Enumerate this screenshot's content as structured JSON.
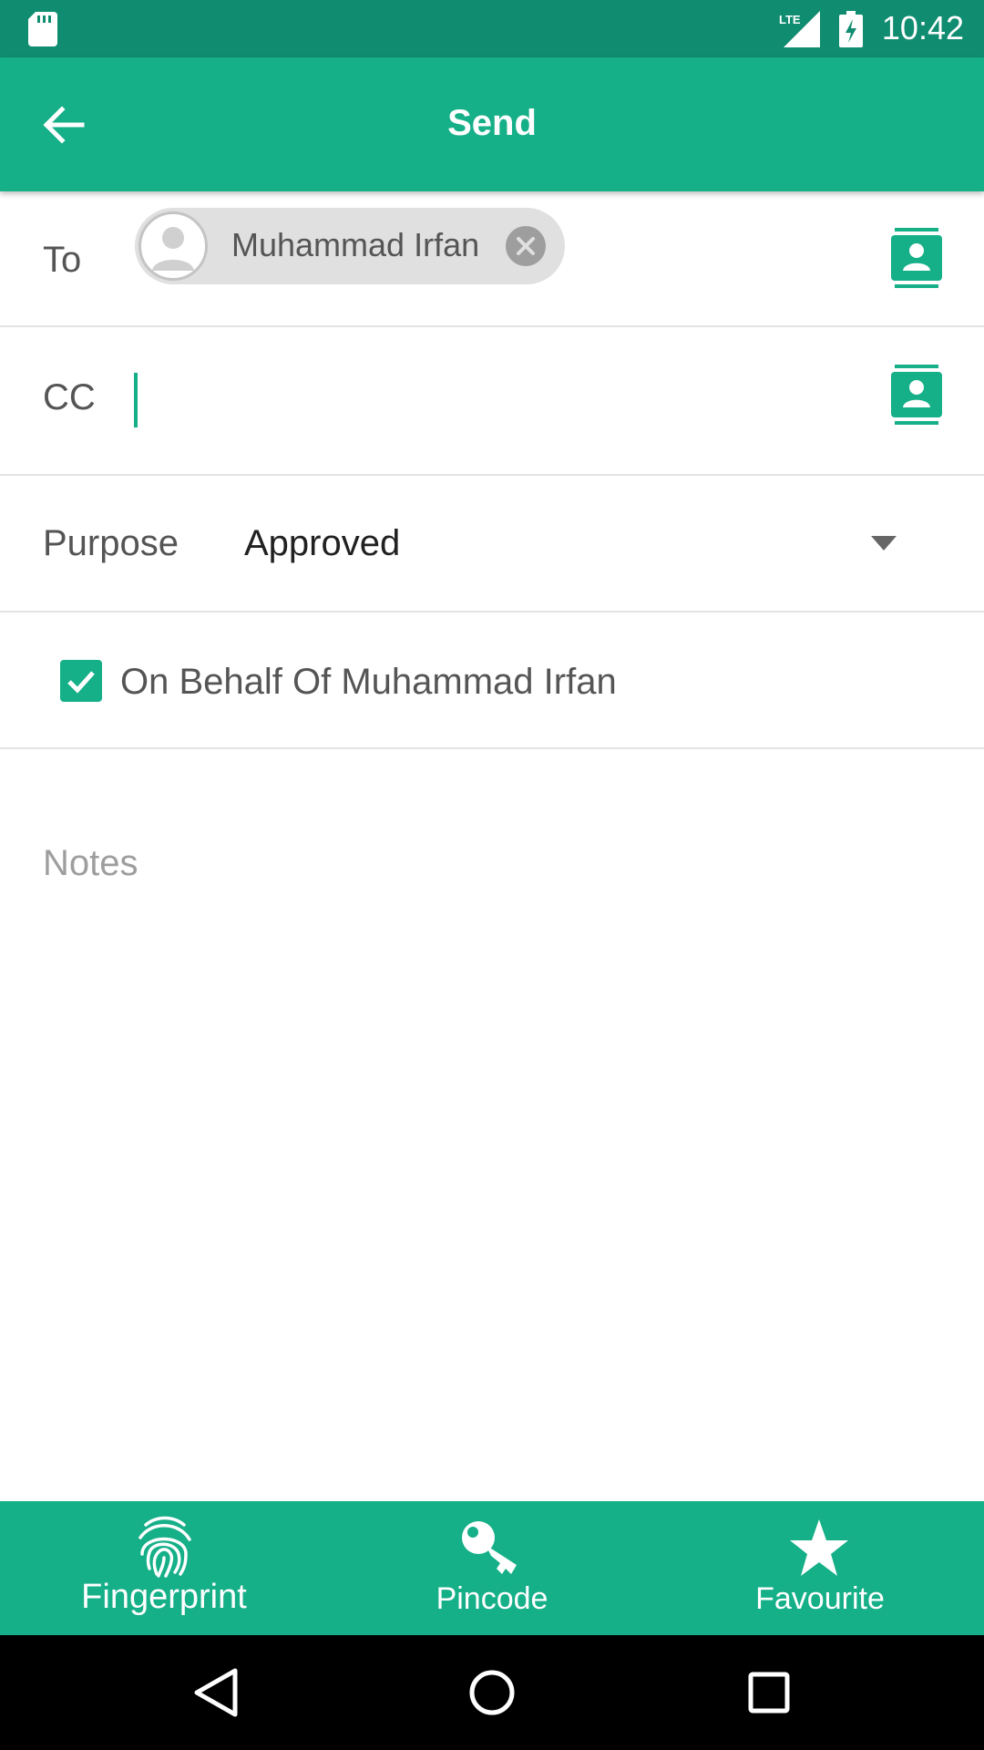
{
  "status_bar": {
    "time": "10:42",
    "network_label": "LTE",
    "icons": [
      "sd-card-icon",
      "lte-signal-icon",
      "battery-charging-icon"
    ]
  },
  "app_bar": {
    "title": "Send",
    "back_icon": "arrow-left-icon"
  },
  "to_field": {
    "label": "To",
    "recipients": [
      {
        "name": "Muhammad Irfan"
      }
    ],
    "contacts_icon": "contact-book-icon"
  },
  "cc_field": {
    "label": "CC",
    "value": "",
    "contacts_icon": "contact-book-icon"
  },
  "purpose_field": {
    "label": "Purpose",
    "selected": "Approved"
  },
  "on_behalf": {
    "label": "On Behalf Of Muhammad Irfan",
    "checked": true
  },
  "notes": {
    "placeholder": "Notes"
  },
  "bottom_tabs": [
    {
      "label": "Fingerprint",
      "icon": "fingerprint-icon"
    },
    {
      "label": "Pincode",
      "icon": "key-icon"
    },
    {
      "label": "Favourite",
      "icon": "star-icon"
    }
  ],
  "nav_bar": {
    "icons": [
      "back-triangle-icon",
      "home-circle-icon",
      "recents-square-icon"
    ]
  },
  "colors": {
    "primary": "#15af88",
    "primary_dark": "#108d71",
    "chip_background": "#e0e0e0",
    "text_label": "#555555",
    "text_value": "#212121",
    "placeholder": "#9e9e9e"
  }
}
